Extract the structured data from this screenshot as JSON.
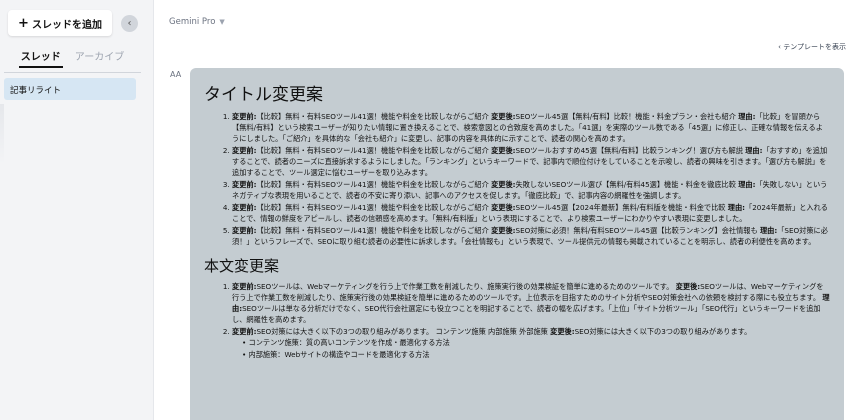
{
  "sidebar": {
    "new_thread_label": "スレッドを追加",
    "tabs": [
      {
        "label": "スレッド",
        "active": true
      },
      {
        "label": "アーカイブ",
        "active": false
      }
    ],
    "threads": [
      {
        "label": "記事リライト"
      }
    ]
  },
  "header": {
    "model": "Gemini Pro",
    "template_link": "テンプレートを表示"
  },
  "message": {
    "avatar": "AA",
    "title_heading": "タイトル変更案",
    "title_items": [
      {
        "before_label": "変更前:",
        "before": "【比較】無料・有料SEOツール41選！機能や料金を比較しながらご紹介",
        "after_label": "変更後:",
        "after": "SEOツール45選【無料/有料】比較！機能・料金プラン・会社も紹介",
        "reason_label": "理由:",
        "reason": "「比較」を冒頭から【無料/有料】という検索ユーザーが知りたい情報に置き換えることで、検索意図との合致度を高めました。「41選」を実際のツール数である「45選」に修正し、正確な情報を伝えるようにしました。「ご紹介」を具体的な「会社も紹介」に変更し、記事の内容を具体的に示すことで、読者の関心を高めます。"
      },
      {
        "before_label": "変更前:",
        "before": "【比較】無料・有料SEOツール41選！機能や料金を比較しながらご紹介",
        "after_label": "変更後:",
        "after": "SEOツールおすすめ45選【無料/有料】比較ランキング！選び方も解説",
        "reason_label": "理由:",
        "reason": "「おすすめ」を追加することで、読者のニーズに直接訴求するようにしました。「ランキング」というキーワードで、記事内で順位付けをしていることを示唆し、読者の興味を引きます。「選び方も解説」を追加することで、ツール選定に悩むユーザーを取り込みます。"
      },
      {
        "before_label": "変更前:",
        "before": "【比較】無料・有料SEOツール41選！機能や料金を比較しながらご紹介",
        "after_label": "変更後:",
        "after": "失敗しないSEOツール選び【無料/有料45選】機能・料金を徹底比較",
        "reason_label": "理由:",
        "reason": "「失敗しない」というネガティブな表現を用いることで、読者の不安に寄り添い、記事へのアクセスを促します。「徹底比較」で、記事内容の網羅性を強調します。"
      },
      {
        "before_label": "変更前:",
        "before": "【比較】無料・有料SEOツール41選！機能や料金を比較しながらご紹介",
        "after_label": "変更後:",
        "after": "SEOツール45選【2024年最新】無料/有料版を機能・料金で比較",
        "reason_label": "理由:",
        "reason": "「2024年最新」と入れることで、情報の鮮度をアピールし、読者の信頼感を高めます。「無料/有料版」という表現にすることで、より検索ユーザーにわかりやすい表現に変更しました。"
      },
      {
        "before_label": "変更前:",
        "before": "【比較】無料・有料SEOツール41選！機能や料金を比較しながらご紹介",
        "after_label": "変更後:",
        "after": "SEO対策に必須！無料/有料SEOツール45選【比較ランキング】会社情報も",
        "reason_label": "理由:",
        "reason": "「SEO対策に必須！」というフレーズで、SEOに取り組む読者の必要性に訴求します。「会社情報も」という表現で、ツール提供元の情報も掲載されていることを明示し、読者の利便性を高めます。"
      }
    ],
    "body_heading": "本文変更案",
    "body_items": [
      {
        "before_label": "変更前:",
        "before": "SEOツールは、Webマーケティングを行う上で作業工数を削減したり、施策実行後の効果検証を簡単に進めるためのツールです。",
        "after_label": "変更後:",
        "after": "SEOツールは、Webマーケティングを行う上で作業工数を削減したり、施策実行後の効果検証を簡単に進めるためのツールです。上位表示を目指すためのサイト分析やSEO対策会社への依頼を検討する際にも役立ちます。",
        "reason_label": "理由:",
        "reason": "SEOツールは単なる分析だけでなく、SEO代行会社選定にも役立つことを明記することで、読者の幅を広げます。「上位」「サイト分析ツール」「SEO代行」というキーワードを追加し、網羅性を高めます。"
      },
      {
        "before_label": "変更前:",
        "before": "SEO対策には大きく以下の3つの取り組みがあります。 コンテンツ施策 内部施策 外部施策",
        "after_label": "変更後:",
        "after": "SEO対策には大きく以下の3つの取り組みがあります。",
        "sub": [
          "コンテンツ施策：質の高いコンテンツを作成・最適化する方法",
          "内部施策：Webサイトの構造やコードを最適化する方法"
        ]
      }
    ]
  }
}
